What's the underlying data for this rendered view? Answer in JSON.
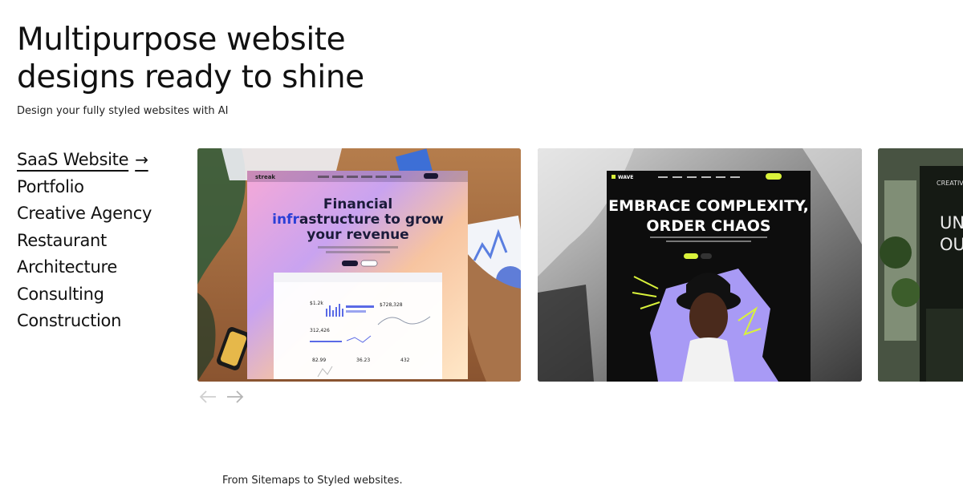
{
  "hero": {
    "title_line1": "Multipurpose website",
    "title_line2": "designs ready to shine",
    "subtitle": "Design your fully styled websites with AI"
  },
  "categories": [
    {
      "label": "SaaS Website",
      "active": true
    },
    {
      "label": "Portfolio",
      "active": false
    },
    {
      "label": "Creative Agency",
      "active": false
    },
    {
      "label": "Restaurant",
      "active": false
    },
    {
      "label": "Architecture",
      "active": false
    },
    {
      "label": "Consulting",
      "active": false
    },
    {
      "label": "Construction",
      "active": false
    }
  ],
  "cards": {
    "saas": {
      "brand": "streak",
      "headline_1": "Financial",
      "headline_2a": "infr",
      "headline_2b": "astructure to grow",
      "headline_3": "your revenue",
      "stats": [
        "$1.2k",
        "$728,328",
        "312,426",
        "82.99",
        "36.23",
        "432"
      ]
    },
    "creative": {
      "brand": "WAVE",
      "headline_1": "EMBRACE COMPLEXITY,",
      "headline_2": "ORDER CHAOS"
    },
    "architecture": {
      "brand": "CREATIVE",
      "headline_1": "UN",
      "headline_2": "OU"
    }
  },
  "footer": {
    "tagline": "From Sitemaps to Styled websites."
  },
  "icons": {
    "active_category": "arrow-right-icon",
    "prev": "arrow-left-icon",
    "next": "arrow-right-icon"
  }
}
